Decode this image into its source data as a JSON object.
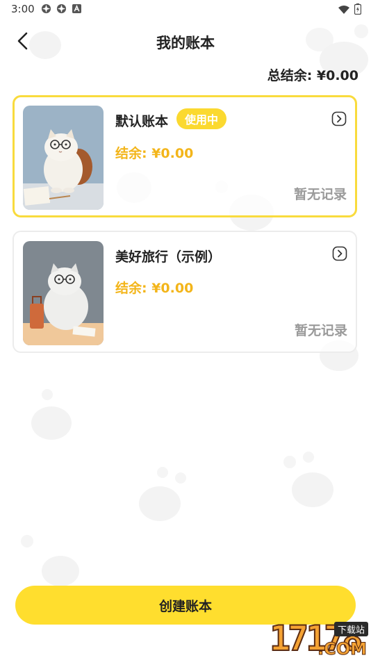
{
  "status_bar": {
    "time": "3:00",
    "notice_icons": [
      "pinwheel-icon",
      "pinwheel-icon",
      "font-a-icon"
    ],
    "right_icons": [
      "wifi-icon",
      "battery-icon"
    ]
  },
  "header": {
    "title": "我的账本",
    "back_icon": "chevron-left-icon"
  },
  "summary": {
    "total_label": "总结余: ¥0.00"
  },
  "ledgers": [
    {
      "name": "默认账本",
      "badge": "使用中",
      "balance": "结余: ¥0.00",
      "status": "暂无记录",
      "active": true
    },
    {
      "name": "美好旅行（示例）",
      "badge": "",
      "balance": "结余: ¥0.00",
      "status": "暂无记录",
      "active": false
    }
  ],
  "actions": {
    "create_label": "创建账本"
  },
  "watermark": {
    "digits": "17178",
    "tag": "下载站",
    "suffix": ".COM"
  },
  "colors": {
    "accent_yellow": "#ffde2e",
    "balance_orange": "#f3b51a",
    "muted_gray": "#9a9a9a",
    "active_border": "#f9db3d"
  }
}
